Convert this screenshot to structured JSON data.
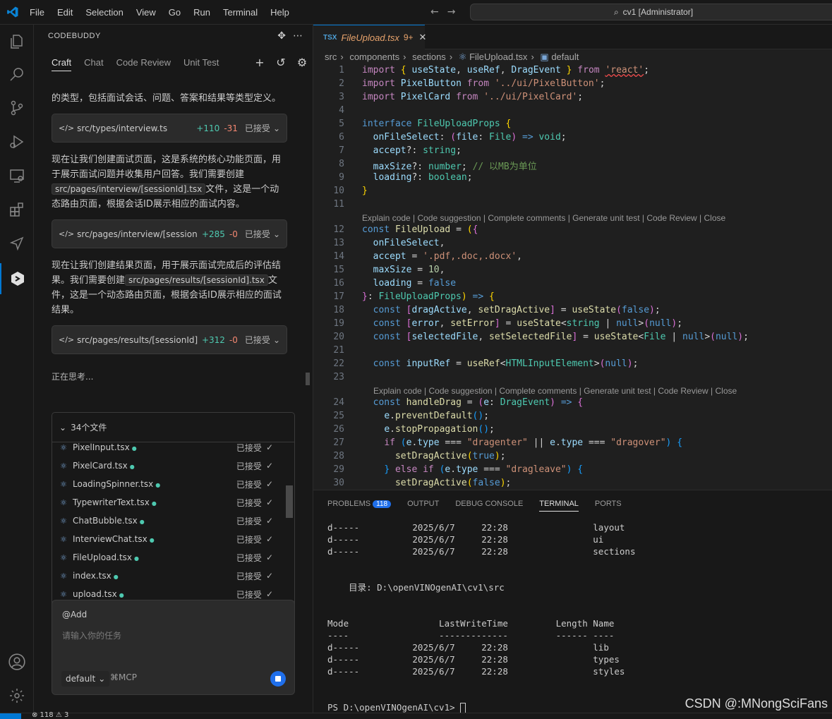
{
  "menu": [
    "File",
    "Edit",
    "Selection",
    "View",
    "Go",
    "Run",
    "Terminal",
    "Help"
  ],
  "search": {
    "text": "cv1 [Administrator]"
  },
  "sidebar": {
    "title": "CODEBUDDY",
    "tabs": [
      "Craft",
      "Chat",
      "Code Review",
      "Unit Test"
    ],
    "messages": {
      "m1": "的类型，包括面试会话、问题、答案和结果等类型定义。",
      "m2a": "现在让我们创建面试页面，这是系统的核心功能页面，用于展示面试问题并收集用户回答。我们需要创建",
      "m2code": "src/pages/interview/[sessionId].tsx",
      "m2b": "文件，这是一个动态路由页面，根据会话ID展示相应的面试内容。",
      "m3a": "现在让我们创建结果页面，用于展示面试完成后的评估结果。我们需要创建",
      "m3code": "src/pages/results/[sessionId].tsx",
      "m3b": "文件，这是一个动态路由页面，根据会话ID展示相应的面试结果。"
    },
    "cards": [
      {
        "file": "src/types/interview.ts",
        "add": "+110",
        "del": "-31",
        "status": "已接受"
      },
      {
        "file": "src/pages/interview/[sessionId]....",
        "add": "+285",
        "del": "-0",
        "status": "已接受"
      },
      {
        "file": "src/pages/results/[sessionId].tsx",
        "add": "+312",
        "del": "-0",
        "status": "已接受"
      }
    ],
    "thinking": "正在思考...",
    "filelist": {
      "header": "34个文件",
      "rows": [
        {
          "name": "PixelInput.tsx",
          "status": "已接受"
        },
        {
          "name": "PixelCard.tsx",
          "status": "已接受"
        },
        {
          "name": "LoadingSpinner.tsx",
          "status": "已接受"
        },
        {
          "name": "TypewriterText.tsx",
          "status": "已接受"
        },
        {
          "name": "ChatBubble.tsx",
          "status": "已接受"
        },
        {
          "name": "InterviewChat.tsx",
          "status": "已接受"
        },
        {
          "name": "FileUpload.tsx",
          "status": "已接受"
        },
        {
          "name": "index.tsx",
          "status": "已接受"
        },
        {
          "name": "upload.tsx",
          "status": "已接受"
        }
      ]
    },
    "input": {
      "add_label": "@Add",
      "placeholder": "请输入你的任务",
      "mode": "default",
      "mcp": "MCP"
    }
  },
  "editor": {
    "tab": {
      "name": "FileUpload.tsx",
      "count": "9+",
      "icon": "TSX"
    },
    "breadcrumb": [
      "src",
      "components",
      "sections",
      "FileUpload.tsx",
      "default"
    ],
    "codelens": "Explain code | Code suggestion | Complete comments | Generate unit test | Code Review | Close"
  },
  "panel": {
    "tabs": [
      "PROBLEMS",
      "OUTPUT",
      "DEBUG CONSOLE",
      "TERMINAL",
      "PORTS"
    ],
    "problems_count": "118",
    "terminal_lines": [
      "d-----          2025/6/7     22:28                layout",
      "d-----          2025/6/7     22:28                ui",
      "d-----          2025/6/7     22:28                sections",
      "",
      "",
      "    目录: D:\\openVINOgenAI\\cv1\\src",
      "",
      "",
      "Mode                 LastWriteTime         Length Name",
      "----                 -------------         ------ ----",
      "d-----          2025/6/7     22:28                lib",
      "d-----          2025/6/7     22:28                types",
      "d-----          2025/6/7     22:28                styles",
      "",
      ""
    ],
    "prompt": "PS D:\\openVINOgenAI\\cv1> "
  },
  "watermark": "CSDN @:MNongSciFans",
  "statusbar": {
    "problems": "⊗ 118 ⚠ 3"
  }
}
